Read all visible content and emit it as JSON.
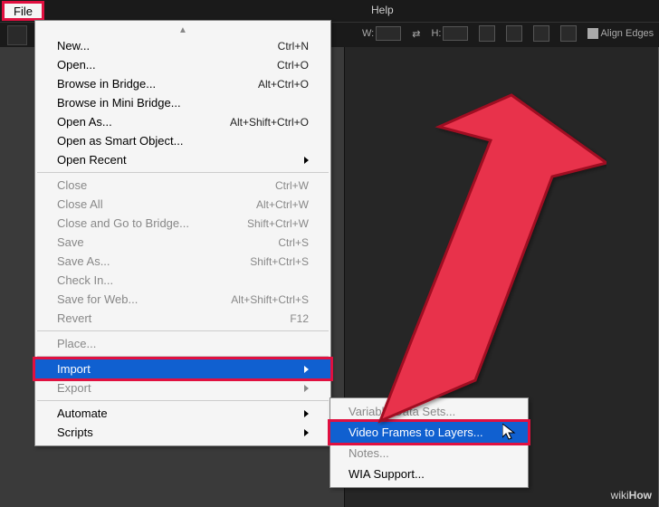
{
  "topbar": {
    "file_label": "File"
  },
  "menubar": {
    "help": "Help"
  },
  "options": {
    "w_label": "W:",
    "h_label": "H:",
    "align_label": "Align Edges"
  },
  "file_menu": {
    "items": [
      {
        "label": "New...",
        "shortcut": "Ctrl+N"
      },
      {
        "label": "Open...",
        "shortcut": "Ctrl+O"
      },
      {
        "label": "Browse in Bridge...",
        "shortcut": "Alt+Ctrl+O"
      },
      {
        "label": "Browse in Mini Bridge...",
        "shortcut": ""
      },
      {
        "label": "Open As...",
        "shortcut": "Alt+Shift+Ctrl+O"
      },
      {
        "label": "Open as Smart Object...",
        "shortcut": ""
      },
      {
        "label": "Open Recent",
        "shortcut": "",
        "submenu": true
      }
    ],
    "group2": [
      {
        "label": "Close",
        "shortcut": "Ctrl+W",
        "disabled": true
      },
      {
        "label": "Close All",
        "shortcut": "Alt+Ctrl+W",
        "disabled": true
      },
      {
        "label": "Close and Go to Bridge...",
        "shortcut": "Shift+Ctrl+W",
        "disabled": true
      },
      {
        "label": "Save",
        "shortcut": "Ctrl+S",
        "disabled": true
      },
      {
        "label": "Save As...",
        "shortcut": "Shift+Ctrl+S",
        "disabled": true
      },
      {
        "label": "Check In...",
        "shortcut": "",
        "disabled": true
      },
      {
        "label": "Save for Web...",
        "shortcut": "Alt+Shift+Ctrl+S",
        "disabled": true
      },
      {
        "label": "Revert",
        "shortcut": "F12",
        "disabled": true
      }
    ],
    "group3": [
      {
        "label": "Place...",
        "shortcut": "",
        "disabled": true
      }
    ],
    "group4": [
      {
        "label": "Import",
        "shortcut": "",
        "submenu": true,
        "highlighted": true
      },
      {
        "label": "Export",
        "shortcut": "",
        "submenu": true,
        "disabled": true
      }
    ],
    "group5": [
      {
        "label": "Automate",
        "shortcut": "",
        "submenu": true
      },
      {
        "label": "Scripts",
        "shortcut": "",
        "submenu": true
      }
    ]
  },
  "import_submenu": {
    "items": [
      {
        "label": "Variable Data Sets...",
        "disabled": true
      },
      {
        "label": "Video Frames to Layers...",
        "highlighted": true
      },
      {
        "label": "Notes...",
        "disabled": true
      },
      {
        "label": "WIA Support...",
        "disabled": false
      }
    ]
  },
  "watermark": {
    "prefix": "wiki",
    "suffix": "How"
  }
}
